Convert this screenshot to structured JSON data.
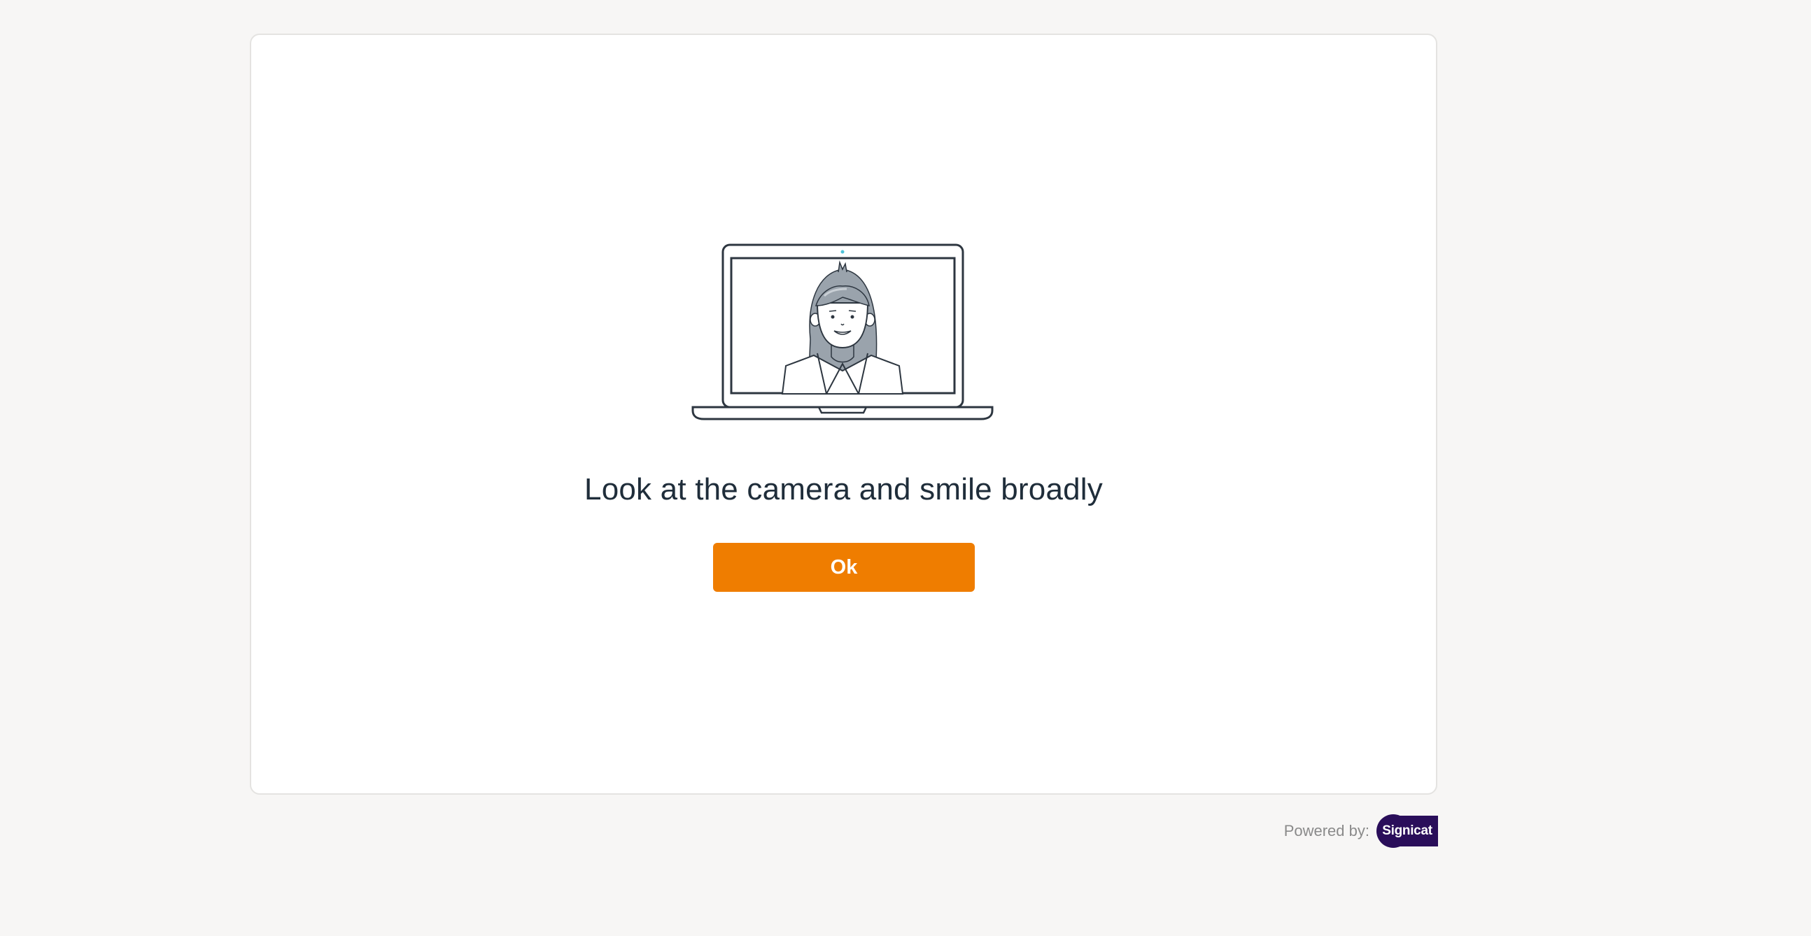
{
  "instruction": {
    "headline": "Look at the camera and smile broadly"
  },
  "actions": {
    "ok_label": "Ok"
  },
  "illustration": {
    "icon": "laptop-with-person-icon"
  },
  "footer": {
    "powered_by_label": "Powered by:",
    "brand_name": "Signicat"
  },
  "colors": {
    "background": "#f7f6f5",
    "card": "#ffffff",
    "accent": "#ef7d00",
    "text": "#1f2d3a",
    "brand": "#2a0e5a"
  }
}
